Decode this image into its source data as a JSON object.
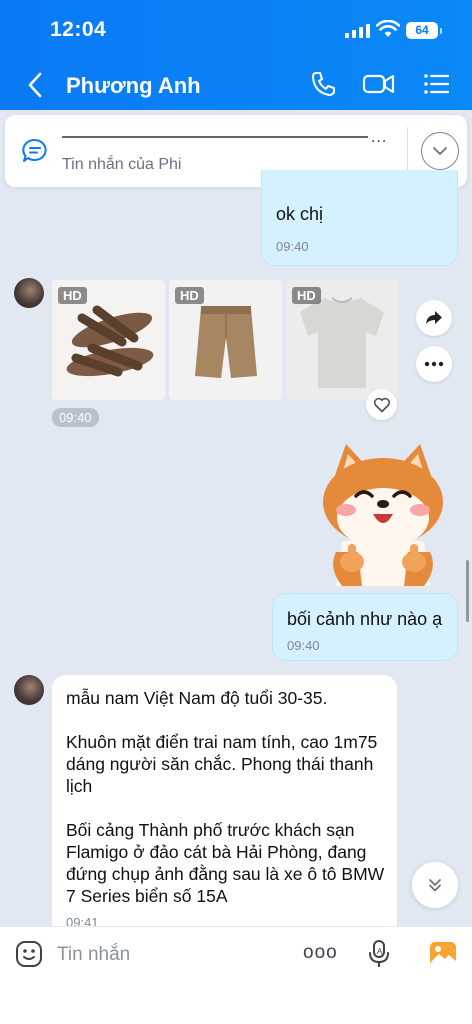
{
  "status_bar": {
    "time": "12:04",
    "battery": "64"
  },
  "header": {
    "contact_name": "Phương Anh"
  },
  "pinned": {
    "subtitle": "Tin nhắn của Phi",
    "ellipsis": "..."
  },
  "messages": {
    "m1": {
      "text": "ok chị",
      "time": "09:40"
    },
    "images": {
      "badge": "HD",
      "time": "09:40"
    },
    "m3": {
      "text": "bối cảnh như nào ạ",
      "time": "09:40"
    },
    "m4": {
      "text": "mẫu nam Việt Nam độ tuổi 30-35.\n\nKhuôn mặt điển trai nam tính, cao 1m75 dáng người săn chắc. Phong thái thanh lịch\n\nBối cảng Thành phố trước khách sạn Flamigo ở đảo cát bà Hải Phòng, đang đứng chụp ảnh đằng sau là xe ô tô BMW 7 Series biển số 15A",
      "time": "09:41"
    }
  },
  "composer": {
    "placeholder": "Tin nhắn",
    "more": "ooo"
  },
  "colors": {
    "header": "#0a7af5",
    "outgoing_bubble": "#d5f1ff",
    "background": "#e2e8f1"
  },
  "icons": [
    "back-icon",
    "phone-icon",
    "video-call-icon",
    "menu-icon",
    "chat-bubble-icon",
    "chevron-down-icon",
    "forward-icon",
    "more-icon",
    "heart-icon",
    "sticker-icon",
    "voice-icon",
    "image-icon"
  ]
}
